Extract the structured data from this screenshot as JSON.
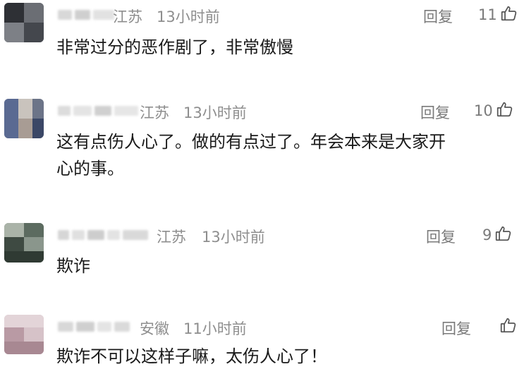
{
  "comments": [
    {
      "region": "江苏",
      "time": "13小时前",
      "reply_label": "回复",
      "like_count": "11",
      "text": "非常过分的恶作剧了，非常傲慢"
    },
    {
      "region": "江苏",
      "time": "13小时前",
      "reply_label": "回复",
      "like_count": "10",
      "text": "这有点伤人心了。做的有点过了。年会本来是大家开\n心的事。"
    },
    {
      "region": "江苏",
      "time": "13小时前",
      "reply_label": "回复",
      "like_count": "9",
      "text": "欺诈"
    },
    {
      "region": "安徽",
      "time": "11小时前",
      "reply_label": "回复",
      "like_count": "",
      "text": "欺诈不可以这样子嘛，太伤人心了！"
    }
  ],
  "icons": {
    "like": "thumbs-up-icon"
  },
  "colors": {
    "meta_text": "#8e8e8e",
    "body_text": "#1a1a1a"
  }
}
